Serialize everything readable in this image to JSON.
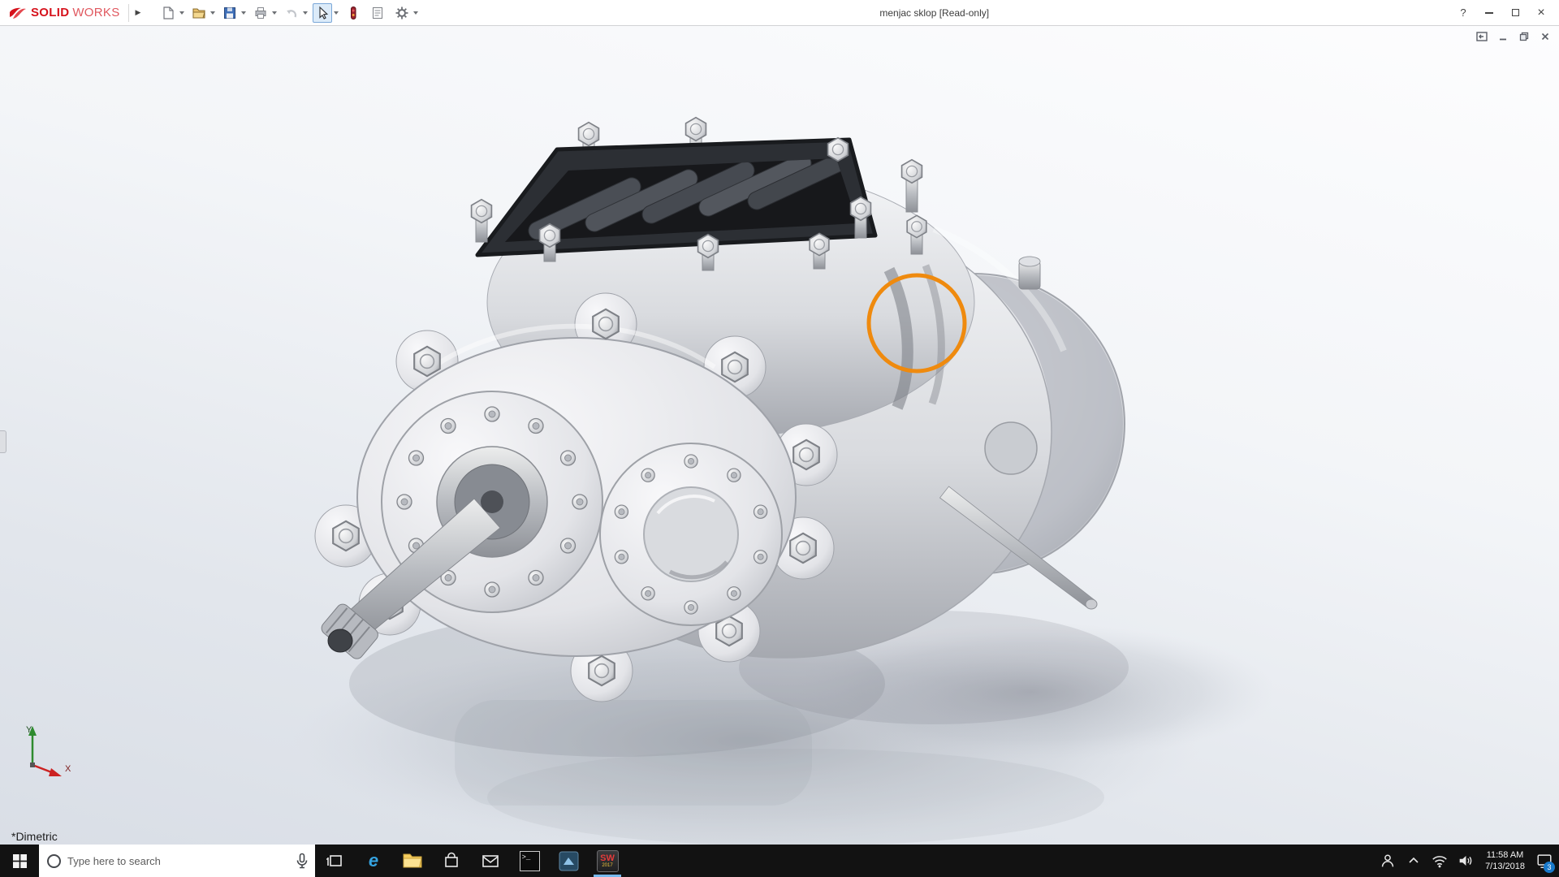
{
  "titlebar": {
    "logo_solid": "SOLID",
    "logo_works": "WORKS",
    "flyout": "▶",
    "title": "menjac sklop [Read-only]",
    "help": "?",
    "close_glyph": "×"
  },
  "doc_controls": {
    "close_glyph": "×"
  },
  "viewport": {
    "orientation": "*Dimetric",
    "triad_x_label": "X",
    "triad_y_label": "Y"
  },
  "taskbar": {
    "search_placeholder": "Type here to search",
    "edge_glyph": "e",
    "terminal_glyph": ">_",
    "solidworks_label": "SW",
    "solidworks_year": "2017",
    "clock": {
      "time": "11:58 AM",
      "date": "7/13/2018"
    },
    "action_center_badge": "3"
  },
  "colors": {
    "annotation": "#ef8a0e",
    "taskbar": "#121212",
    "accent": "#1979ca",
    "logo_red": "#d6121c"
  },
  "icons": {
    "toolbar": [
      "new-document-icon",
      "open-icon",
      "save-icon",
      "print-icon",
      "undo-icon",
      "select-cursor-icon",
      "rebuild-icon",
      "sheet-icon",
      "options-gear-icon"
    ],
    "tray": [
      "people-icon",
      "chevron-up-icon",
      "wifi-icon",
      "volume-icon",
      "action-center-icon"
    ]
  }
}
